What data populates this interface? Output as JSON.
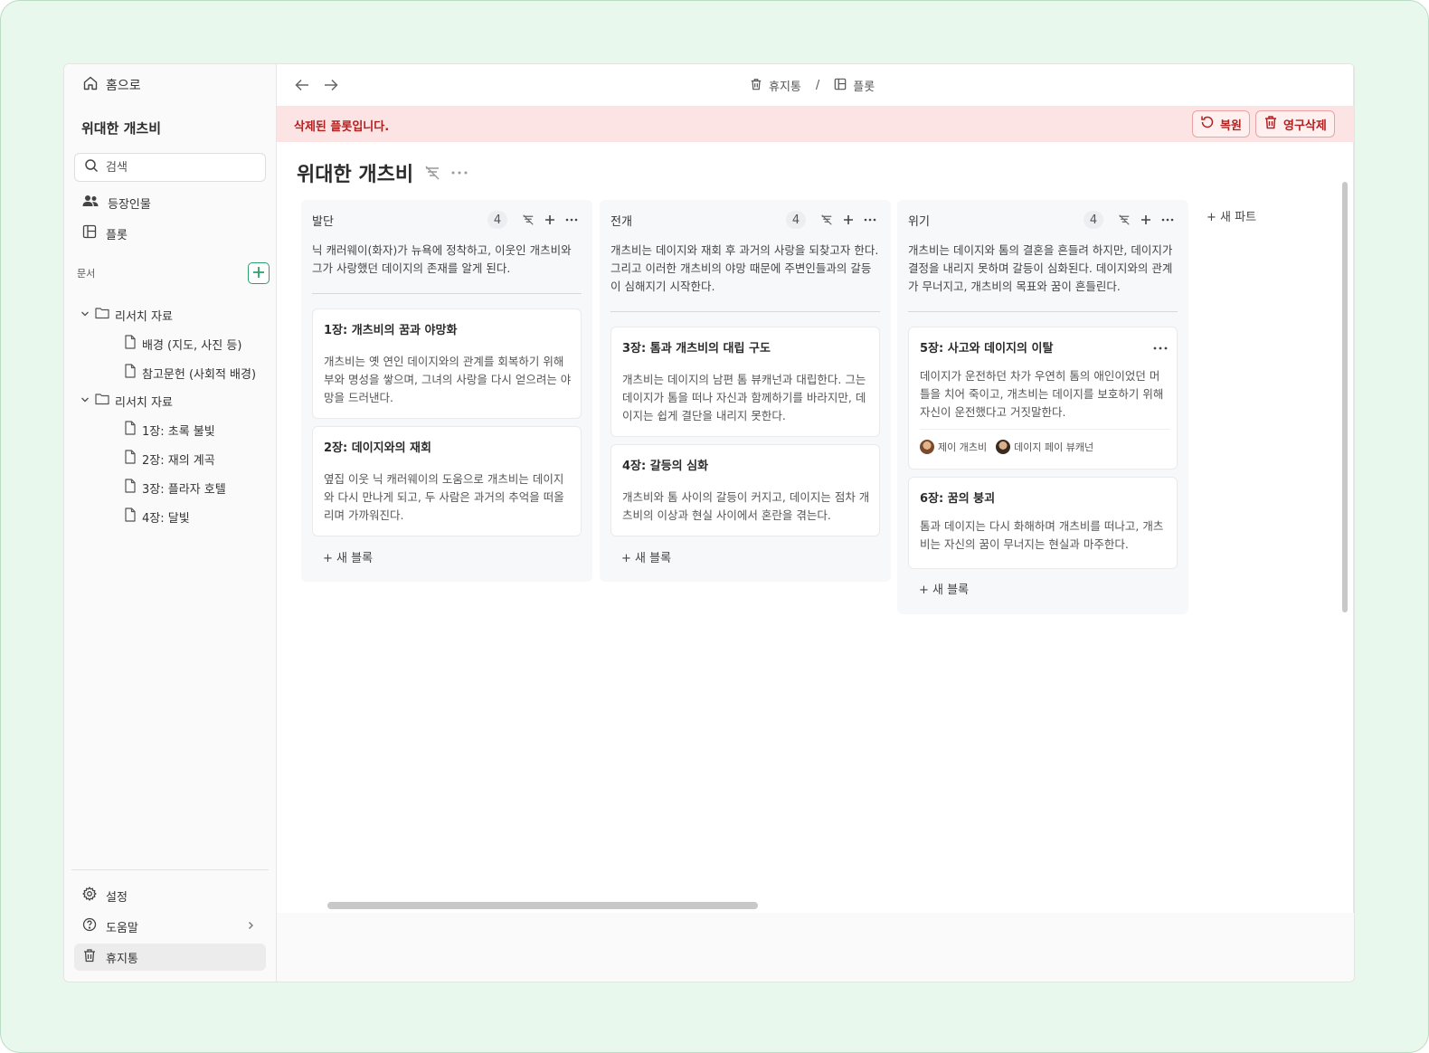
{
  "sidebar": {
    "home_label": "홈으로",
    "project_title": "위대한 개츠비",
    "search_placeholder": "검색",
    "nav": [
      {
        "label": "등장인물",
        "icon": "people-icon"
      },
      {
        "label": "플롯",
        "icon": "board-icon"
      }
    ],
    "docs_section": "문서",
    "tree": [
      {
        "label": "리서치 자료",
        "type": "folder"
      },
      {
        "label": "배경 (지도, 사진 등)",
        "type": "file"
      },
      {
        "label": "참고문헌 (사회적 배경)",
        "type": "file"
      },
      {
        "label": "리서치 자료",
        "type": "folder"
      },
      {
        "label": "1장: 초록 불빛",
        "type": "file"
      },
      {
        "label": "2장: 재의 계곡",
        "type": "file"
      },
      {
        "label": "3장: 플라자 호텔",
        "type": "file"
      },
      {
        "label": "4장: 달빛",
        "type": "file"
      }
    ],
    "footer": {
      "settings": "설정",
      "help": "도움말",
      "trash": "휴지통"
    }
  },
  "topbar": {
    "crumbs": [
      "휴지통",
      "플롯"
    ],
    "separator": "/"
  },
  "banner": {
    "message": "삭제된 플롯입니다.",
    "restore": "복원",
    "delete_forever": "영구삭제",
    "color": "#b22020",
    "background": "#fde4e4"
  },
  "board": {
    "title": "위대한 개츠비",
    "new_block": "+ 새 블록",
    "new_part": "+ 새 파트",
    "columns": [
      {
        "name": "발단",
        "count": "4",
        "description": "닉 캐러웨이(화자)가 뉴욕에 정착하고, 이웃인 개츠비와 그가 사랑했던 데이지의 존재를 알게 된다.",
        "cards": [
          {
            "title": "1장: 개츠비의 꿈과 야망화",
            "body": "개츠비는 옛 연인 데이지와의 관계를 회복하기 위해 부와 명성을 쌓으며, 그녀의 사랑을 다시 얻으려는 야망을 드러낸다."
          },
          {
            "title": "2장: 데이지와의 재회",
            "body": "옆집 이웃 닉 캐러웨이의 도움으로 개츠비는 데이지와 다시 만나게 되고, 두 사람은 과거의 추억을 떠올리며 가까워진다."
          }
        ]
      },
      {
        "name": "전개",
        "count": "4",
        "description": "개츠비는 데이지와 재회 후 과거의 사랑을 되찾고자 한다. 그리고 이러한 개츠비의 야망 때문에 주변인들과의 갈등이 심해지기 시작한다.",
        "cards": [
          {
            "title": "3장: 톰과 개츠비의 대립 구도",
            "body": "개츠비는 데이지의 남편 톰 뷰캐넌과 대립한다. 그는 데이지가 톰을 떠나 자신과 함께하기를 바라지만, 데이지는 쉽게 결단을 내리지 못한다."
          },
          {
            "title": "4장: 갈등의 심화",
            "body": "개츠비와 톰 사이의 갈등이 커지고, 데이지는 점차 개츠비의 이상과 현실 사이에서 혼란을 겪는다."
          }
        ]
      },
      {
        "name": "위기",
        "count": "4",
        "description": "개츠비는 데이지와 톰의 결혼을 흔들려 하지만, 데이지가 결정을 내리지 못하며 갈등이 심화된다. 데이지와의 관계가 무너지고, 개츠비의 목표와 꿈이 흔들린다.",
        "cards": [
          {
            "title": "5장: 사고와 데이지의 이탈",
            "body": "데이지가 운전하던 차가 우연히 톰의 애인이었던 머틀을 치어 죽이고, 개츠비는 데이지를 보호하기 위해 자신이 운전했다고 거짓말한다.",
            "characters": [
              "제이 개츠비",
              "데이지 페이 뷰캐넌"
            ]
          },
          {
            "title": "6장: 꿈의 붕괴",
            "body": "톰과 데이지는 다시 화해하며 개츠비를 떠나고, 개츠비는 자신의 꿈이 무너지는 현실과 마주한다."
          }
        ]
      }
    ]
  },
  "colors": {
    "accent": "#2aa06a",
    "backdrop": "#e9f8ec"
  }
}
